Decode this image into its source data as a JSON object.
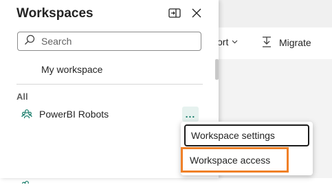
{
  "toolbar": {
    "import_label": "ort",
    "migrate_label": "Migrate"
  },
  "panel": {
    "title": "Workspaces",
    "search": {
      "placeholder": "Search",
      "value": ""
    },
    "my_workspace_label": "My workspace",
    "section_label": "All",
    "workspaces": [
      {
        "label": "PowerBI Robots",
        "more_label": "..."
      }
    ]
  },
  "context_menu": {
    "items": [
      {
        "label": "Workspace settings"
      },
      {
        "label": "Workspace access"
      }
    ]
  },
  "colors": {
    "accent": "#117865",
    "highlight": "#f08027"
  }
}
